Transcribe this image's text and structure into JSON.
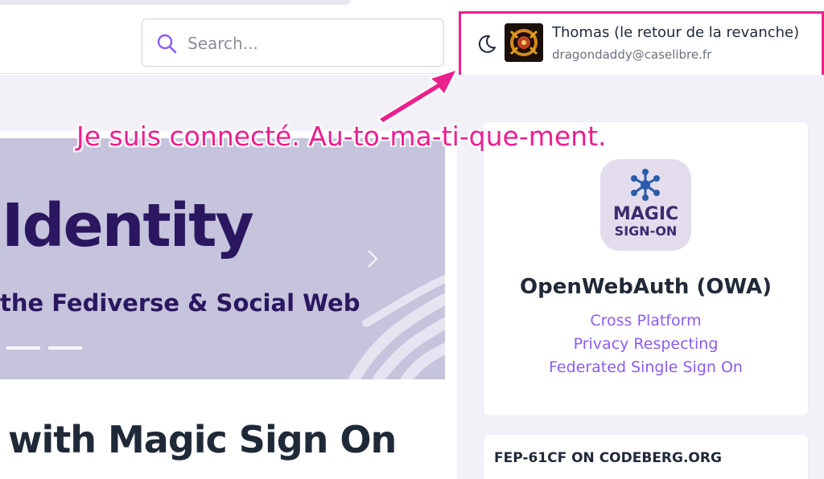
{
  "header": {
    "search": {
      "placeholder": "Search..."
    },
    "user": {
      "name": "Thomas (le retour de la revanche)",
      "email": "dragondaddy@caselibre.fr"
    }
  },
  "annotation": {
    "text": "Je suis connecté. Au-to-ma-ti-que-ment.",
    "color": "#ec1f8e"
  },
  "hero": {
    "title": "Identity",
    "subtitle": "the Fediverse & Social Web",
    "slide_count_visible": 2
  },
  "main": {
    "heading": "with Magic Sign On"
  },
  "sidebar": {
    "owa_card": {
      "logo_line1": "MAGIC",
      "logo_line2": "SIGN-ON",
      "title": "OpenWebAuth (OWA)",
      "lines": [
        "Cross Platform",
        "Privacy Respecting",
        "Federated Single Sign On"
      ]
    },
    "fep_card": {
      "title": "FEP-61CF ON CODEBERG.ORG"
    }
  },
  "colors": {
    "accent": "#8b5cf6",
    "hero_bg": "#c6c3dc",
    "hero_text": "#2a1760",
    "sidebar_bg": "#f3f1f8"
  }
}
